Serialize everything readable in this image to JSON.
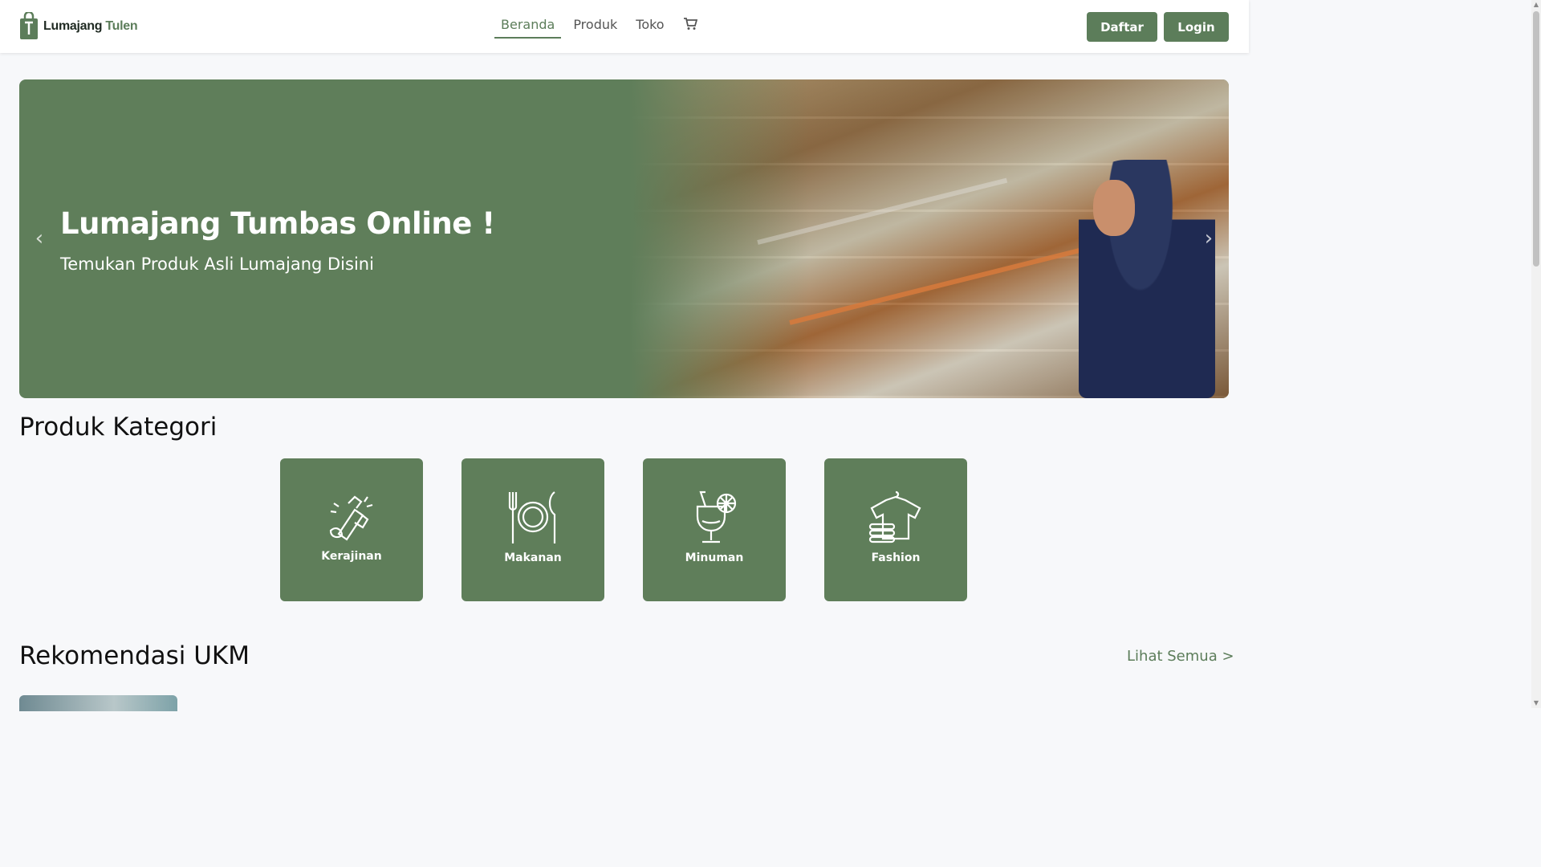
{
  "navbar": {
    "brand": {
      "name_part1": "Lumajang",
      "name_part2": "Tulen"
    },
    "links": [
      {
        "label": "Beranda",
        "active": true
      },
      {
        "label": "Produk",
        "active": false
      },
      {
        "label": "Toko",
        "active": false
      }
    ],
    "cart_icon": "cart-icon",
    "buttons": {
      "register": "Daftar",
      "login": "Login"
    }
  },
  "hero": {
    "title": "Lumajang Tumbas Online !",
    "subtitle": "Temukan Produk Asli Lumajang Disini",
    "prev_icon": "chevron-left-icon",
    "next_icon": "chevron-right-icon"
  },
  "categories_section": {
    "title": "Produk Kategori",
    "items": [
      {
        "label": "Kerajinan",
        "icon": "crafts-icon"
      },
      {
        "label": "Makanan",
        "icon": "plate-cutlery-icon"
      },
      {
        "label": "Minuman",
        "icon": "drink-glass-icon"
      },
      {
        "label": "Fashion",
        "icon": "clothing-icon"
      }
    ]
  },
  "ukm_section": {
    "title": "Rekomendasi UKM",
    "see_all": "Lihat Semua >"
  },
  "colors": {
    "primary": "#5c7d5a",
    "background": "#f7f8fa",
    "white": "#ffffff"
  }
}
